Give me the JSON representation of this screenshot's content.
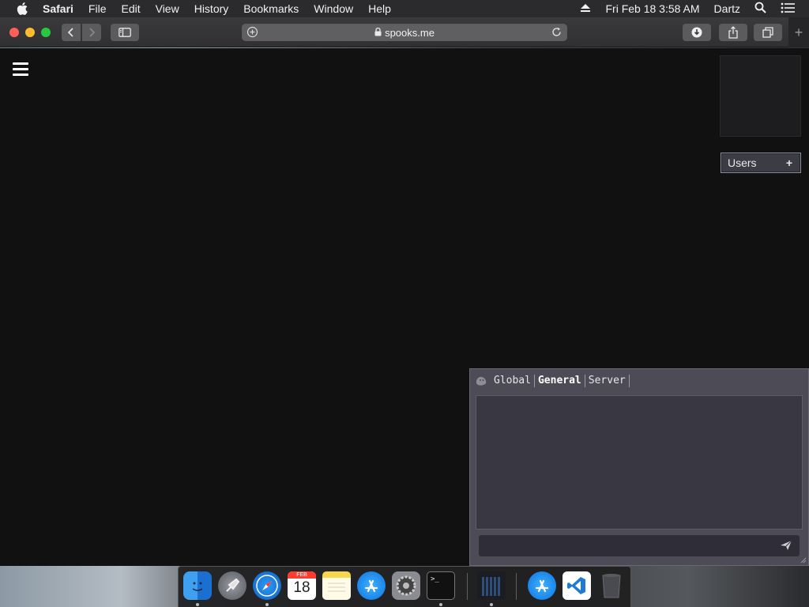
{
  "menubar": {
    "app_name": "Safari",
    "items": [
      "File",
      "Edit",
      "View",
      "History",
      "Bookmarks",
      "Window",
      "Help"
    ],
    "datetime": "Fri Feb 18  3:58 AM",
    "user": "Dartz"
  },
  "browser": {
    "url": "spooks.me"
  },
  "page": {
    "users_label": "Users",
    "users_add": "+"
  },
  "chat": {
    "tabs": [
      {
        "label": "Global",
        "active": false
      },
      {
        "label": "General",
        "active": true
      },
      {
        "label": "Server",
        "active": false
      }
    ],
    "input_value": ""
  },
  "dock": {
    "calendar_month": "FEB",
    "calendar_day": "18",
    "terminal_prompt": ">_"
  },
  "colors": {
    "page_bg": "#111112",
    "chat_panel": "#4d4b55",
    "chat_log": "#393742",
    "users_button": "#3b3c44"
  }
}
